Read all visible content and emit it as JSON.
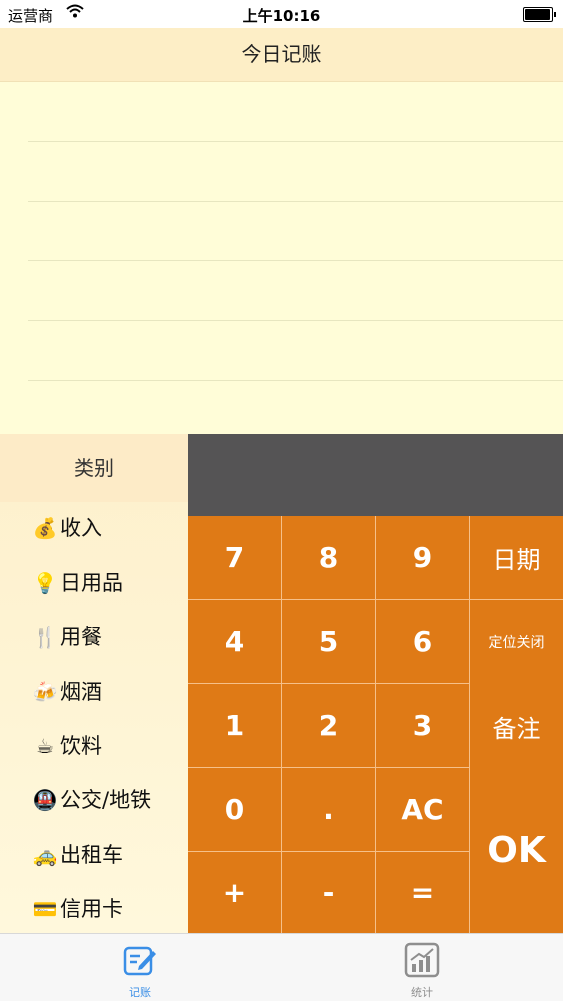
{
  "status_bar": {
    "carrier": "运营商",
    "wifi_icon": "wifi-icon",
    "time": "上午10:16",
    "battery_icon": "battery-icon"
  },
  "nav": {
    "title": "今日记账"
  },
  "categories": {
    "header": "类别",
    "items": [
      {
        "icon": "💰",
        "icon_name": "money-bag-icon",
        "label": "收入"
      },
      {
        "icon": "💡",
        "icon_name": "light-bulb-icon",
        "label": "日用品"
      },
      {
        "icon": "🍴",
        "icon_name": "fork-knife-icon",
        "label": "用餐"
      },
      {
        "icon": "🍻",
        "icon_name": "beer-mugs-icon",
        "label": "烟酒"
      },
      {
        "icon": "☕",
        "icon_name": "coffee-icon",
        "label": "饮料"
      },
      {
        "icon": "🚇",
        "icon_name": "metro-icon",
        "label": "公交/地铁"
      },
      {
        "icon": "🚕",
        "icon_name": "taxi-icon",
        "label": "出租车"
      },
      {
        "icon": "💳",
        "icon_name": "credit-card-icon",
        "label": "信用卡"
      }
    ]
  },
  "display": {
    "value": ""
  },
  "keypad": {
    "keys": [
      {
        "label": "7",
        "name": "key-7"
      },
      {
        "label": "8",
        "name": "key-8"
      },
      {
        "label": "9",
        "name": "key-9"
      },
      {
        "label": "4",
        "name": "key-4"
      },
      {
        "label": "5",
        "name": "key-5"
      },
      {
        "label": "6",
        "name": "key-6"
      },
      {
        "label": "1",
        "name": "key-1"
      },
      {
        "label": "2",
        "name": "key-2"
      },
      {
        "label": "3",
        "name": "key-3"
      },
      {
        "label": "0",
        "name": "key-0"
      },
      {
        "label": ".",
        "name": "key-decimal"
      },
      {
        "label": "AC",
        "name": "key-clear"
      },
      {
        "label": "+",
        "name": "key-plus"
      },
      {
        "label": "-",
        "name": "key-minus"
      },
      {
        "label": "=",
        "name": "key-equals"
      }
    ],
    "date": "日期",
    "location": "定位关闭",
    "note": "备注",
    "ok": "OK"
  },
  "tabs": [
    {
      "label": "记账",
      "icon": "edit-icon",
      "active": true
    },
    {
      "label": "统计",
      "icon": "chart-icon",
      "active": false
    }
  ],
  "colors": {
    "accent": "#df7a16",
    "key_divider": "#f6c089",
    "display_bg": "#555455",
    "nav_bg": "#fdeec6",
    "ledger_bg": "#fffdd8",
    "tab_active": "#3a8ee6",
    "tab_inactive": "#8e8e8e"
  }
}
